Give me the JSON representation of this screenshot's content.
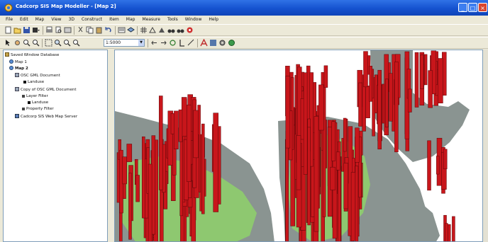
{
  "window": {
    "title": "Cadcorp SIS Map Modeller - [Map 2]"
  },
  "menu": [
    "File",
    "Edit",
    "Map",
    "View",
    "3D",
    "Construct",
    "Item",
    "Map",
    "Measure",
    "Tools",
    "Window",
    "Help"
  ],
  "toolbar": {
    "scale_value": "1:5000"
  },
  "tree": {
    "root": "Saved Window Database",
    "map1": "Map 1",
    "map2": "Map 2",
    "item1": "OSC GML Document",
    "item1a": "Landuse",
    "item2": "Copy of OSC GML Document",
    "item2a": "Layer Filter",
    "item2b": "Landuse",
    "item2c": "Property Filter",
    "item3": "Cadcorp SIS Web Map Server"
  },
  "colors": {
    "water": "#ffffff",
    "land": "#8a9491",
    "green_space": "#8ec870",
    "buildings": "#c8161b",
    "building_edge": "#5a0608",
    "titlebar": "#1552cf"
  }
}
